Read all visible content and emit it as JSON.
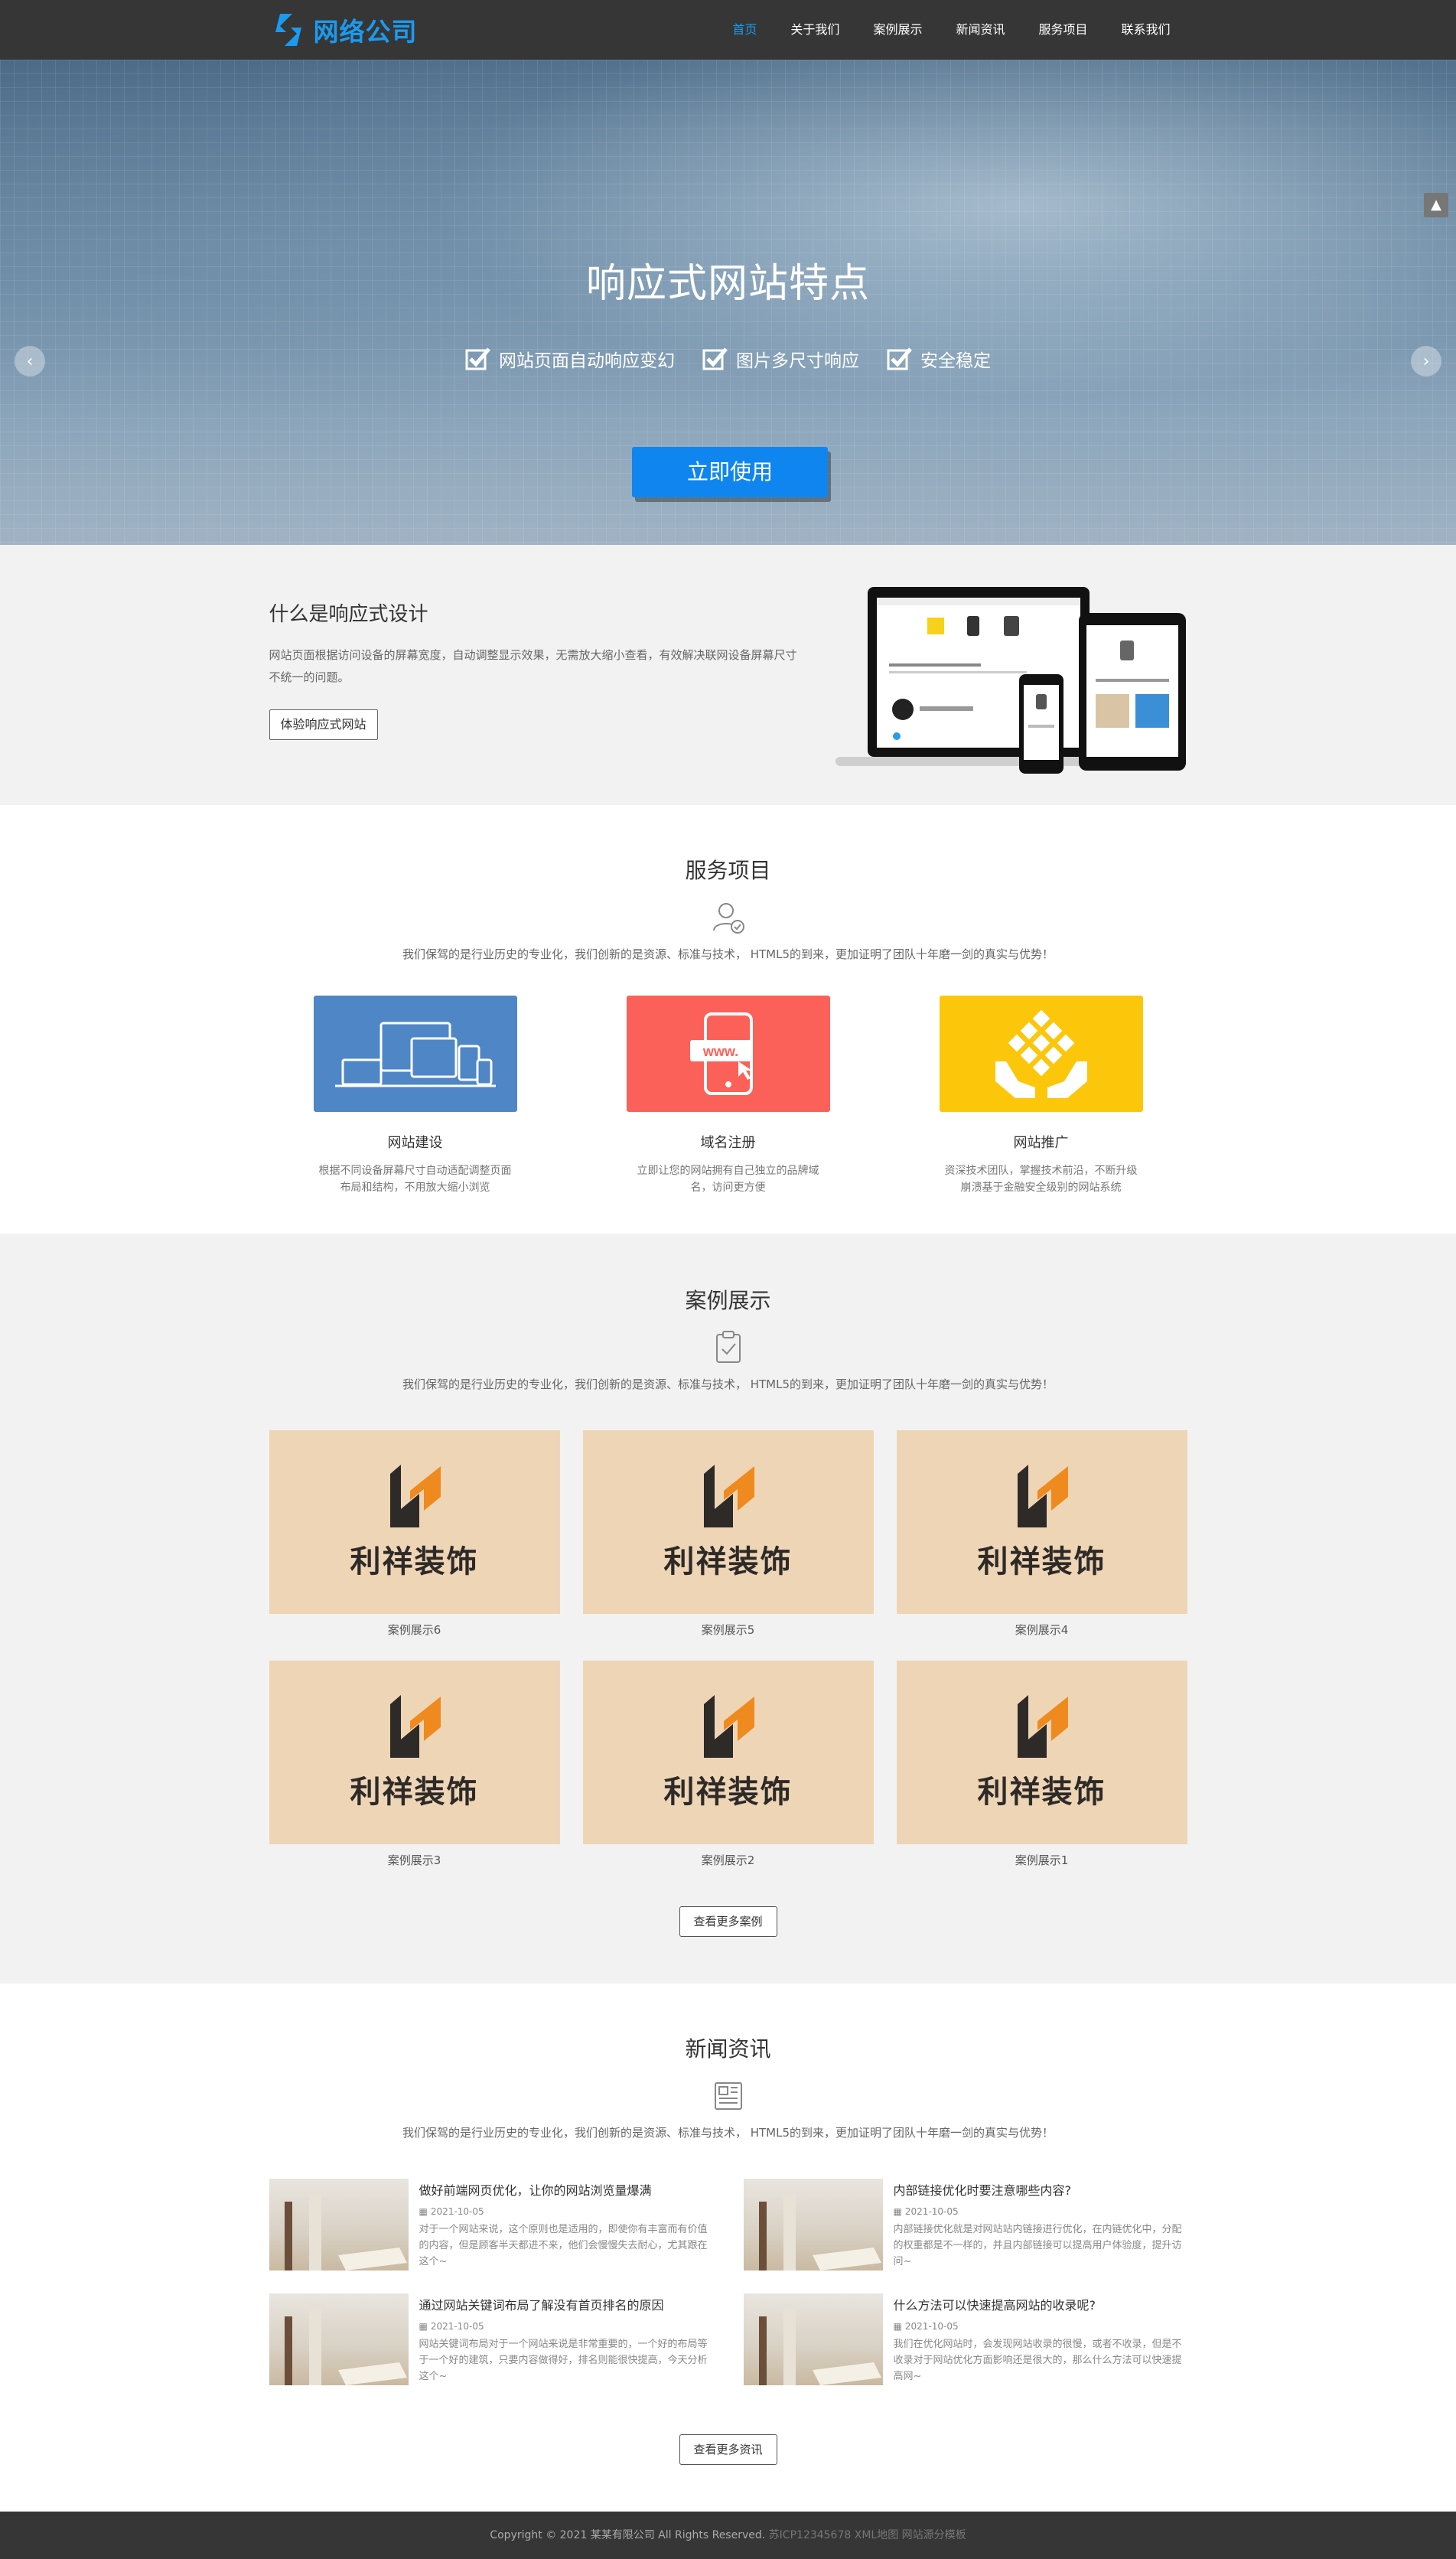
{
  "header": {
    "logo_text": "网络公司",
    "nav": [
      {
        "label": "首页",
        "active": true
      },
      {
        "label": "关于我们"
      },
      {
        "label": "案例展示"
      },
      {
        "label": "新闻资讯"
      },
      {
        "label": "服务项目"
      },
      {
        "label": "联系我们"
      }
    ]
  },
  "banner": {
    "title": "响应式网站特点",
    "features": [
      "网站页面自动响应变幻",
      "图片多尺寸响应",
      "安全稳定"
    ],
    "button": "立即使用",
    "prev_icon": "chevron-left-icon",
    "next_icon": "chevron-right-icon"
  },
  "intro": {
    "title": "什么是响应式设计",
    "desc": "网站页面根据访问设备的屏幕宽度，自动调整显示效果，无需放大缩小查看，有效解决联网设备屏幕尺寸不统一的问题。",
    "button": "体验响应式网站"
  },
  "services": {
    "title": "服务项目",
    "desc": "我们保驾的是行业历史的专业化，我们创新的是资源、标准与技术， HTML5的到来，更加证明了团队十年磨一剑的真实与优势！",
    "items": [
      {
        "name": "网站建设",
        "text": "根据不同设备屏幕尺寸自动适配调整页面布局和结构，不用放大缩小浏览",
        "color": "#4f86c6"
      },
      {
        "name": "域名注册",
        "text": "立即让您的网站拥有自己独立的品牌域名，访问更方便",
        "color": "#fb6159"
      },
      {
        "name": "网站推广",
        "text": "资深技术团队，掌握技术前沿，不断升级崩溃基于金融安全级别的网站系统",
        "color": "#fcc60b"
      }
    ]
  },
  "cases": {
    "title": "案例展示",
    "desc": "我们保驾的是行业历史的专业化，我们创新的是资源、标准与技术， HTML5的到来，更加证明了团队十年磨一剑的真实与优势！",
    "brand": "利祥装饰",
    "items": [
      "案例展示6",
      "案例展示5",
      "案例展示4",
      "案例展示3",
      "案例展示2",
      "案例展示1"
    ],
    "more": "查看更多案例"
  },
  "news": {
    "title": "新闻资讯",
    "desc": "我们保驾的是行业历史的专业化，我们创新的是资源、标准与技术， HTML5的到来，更加证明了团队十年磨一剑的真实与优势！",
    "items": [
      {
        "title": "做好前端网页优化，让你的网站浏览量爆满",
        "date": "2021-10-05",
        "text": "对于一个网站来说，这个原则也是适用的，即使你有丰富而有价值的内容，但是顾客半天都进不来，他们会慢慢失去耐心，尤其跟在这个~"
      },
      {
        "title": "内部链接优化时要注意哪些内容?",
        "date": "2021-10-05",
        "text": "内部链接优化就是对网站站内链接进行优化，在内链优化中，分配的权重都是不一样的，并且内部链接可以提高用户体验度，提升访问~"
      },
      {
        "title": "通过网站关键词布局了解没有首页排名的原因",
        "date": "2021-10-05",
        "text": "网站关键词布局对于一个网站来说是非常重要的，一个好的布局等于一个好的建筑，只要内容做得好，排名则能很快提高，今天分析这个~"
      },
      {
        "title": "什么方法可以快速提高网站的收录呢?",
        "date": "2021-10-05",
        "text": "我们在优化网站时，会发现网站收录的很慢，或者不收录，但是不收录对于网站优化方面影响还是很大的，那么什么方法可以快速提高网~"
      }
    ],
    "more": "查看更多资讯"
  },
  "footer": {
    "copyright": "Copyright © 2021 某某有限公司 All Rights Reserved.",
    "extra": "苏ICP12345678 XML地图 网站源分模板"
  },
  "back_top_icon": "arrow-up-icon"
}
